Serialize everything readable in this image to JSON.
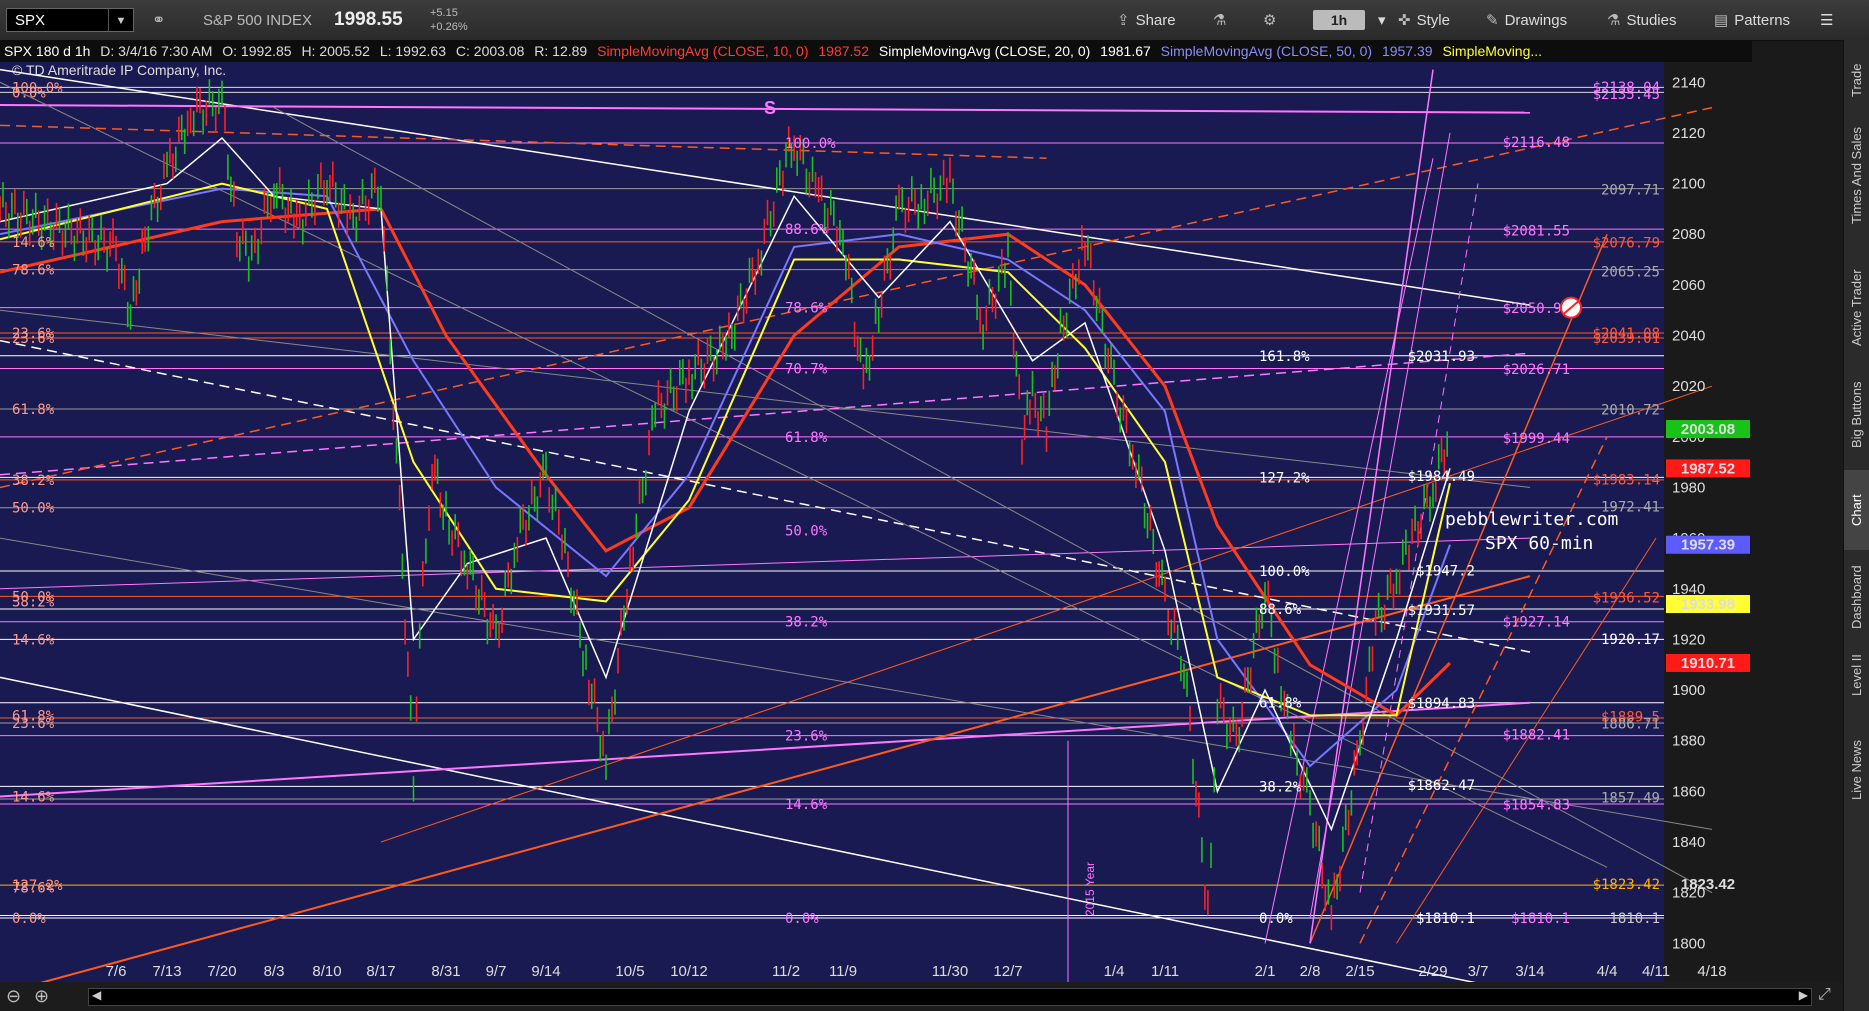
{
  "toolbar": {
    "symbol": "SPX",
    "index_name": "S&P 500 INDEX",
    "last_price": "1998.55",
    "change": "+5.15",
    "change_pct": "+0.26%",
    "share": "Share",
    "timeframe": "1h",
    "style": "Style",
    "drawings": "Drawings",
    "studies": "Studies",
    "patterns": "Patterns"
  },
  "infobar": {
    "title": "SPX 180 d 1h",
    "date": "D: 3/4/16 7:30 AM",
    "open": "O: 1992.85",
    "high": "H: 2005.52",
    "low": "L: 1992.63",
    "close": "C: 2003.08",
    "range": "R: 12.89",
    "sma10": "SimpleMovingAvg (CLOSE, 10, 0)",
    "sma10_val": "1987.52",
    "sma20": "SimpleMovingAvg (CLOSE, 20, 0)",
    "sma20_val": "1981.67",
    "sma50": "SimpleMovingAvg (CLOSE, 50, 0)",
    "sma50_val": "1957.39",
    "sma_more": "SimpleMoving..."
  },
  "sidebar": [
    "Trade",
    "Times And Sales",
    "Active Trader",
    "Big Buttons",
    "Chart",
    "Dashboard",
    "Level II",
    "Live News"
  ],
  "colors": {
    "background": "#1a1a52",
    "sma10": "#ffffff",
    "sma20": "#ffff33",
    "sma50": "#7777ff",
    "sma100": "#ff3b1e",
    "fib_pink": "#ff77ff",
    "orange": "#ff5a1e",
    "gray": "#999999"
  },
  "annotations": {
    "copyright": "© TD Ameritrade IP Company, Inc.",
    "watermark_site": "pebblewriter.com",
    "watermark_tf": "SPX 60-min",
    "s_marker": "S",
    "year_marker": "2015 Year"
  },
  "chart_data": {
    "type": "line",
    "title": "SPX 180 d 1h",
    "ylim": [
      1795,
      2148
    ],
    "yticks": [
      1800,
      1820,
      1840,
      1860,
      1880,
      1900,
      1920,
      1940,
      1960,
      1980,
      2000,
      2020,
      2040,
      2060,
      2080,
      2100,
      2120,
      2140
    ],
    "xticks": [
      "7/6",
      "7/13",
      "7/20",
      "8/3",
      "8/10",
      "8/17",
      "8/31",
      "9/7",
      "9/14",
      "10/5",
      "10/12",
      "11/2",
      "11/9",
      "11/30",
      "12/7",
      "1/4",
      "1/11",
      "2/1",
      "2/8",
      "2/15",
      "2/29",
      "3/7",
      "3/14",
      "4/4",
      "4/11",
      "4/18"
    ],
    "price_series": {
      "name": "SPX",
      "points": [
        [
          "7/1",
          2090
        ],
        [
          "7/6",
          2075
        ],
        [
          "7/8",
          2046
        ],
        [
          "7/10",
          2080
        ],
        [
          "7/13",
          2105
        ],
        [
          "7/16",
          2128
        ],
        [
          "7/20",
          2132
        ],
        [
          "7/24",
          2080
        ],
        [
          "7/28",
          2070
        ],
        [
          "8/3",
          2100
        ],
        [
          "8/6",
          2083
        ],
        [
          "8/10",
          2102
        ],
        [
          "8/13",
          2085
        ],
        [
          "8/17",
          2100
        ],
        [
          "8/21",
          1970
        ],
        [
          "8/24",
          1867
        ],
        [
          "8/26",
          1940
        ],
        [
          "8/28",
          1990
        ],
        [
          "8/31",
          1968
        ],
        [
          "9/3",
          1950
        ],
        [
          "9/7",
          1920
        ],
        [
          "9/10",
          1960
        ],
        [
          "9/14",
          1985
        ],
        [
          "9/18",
          1960
        ],
        [
          "9/24",
          1910
        ],
        [
          "9/29",
          1872
        ],
        [
          "10/5",
          1950
        ],
        [
          "10/8",
          2010
        ],
        [
          "10/12",
          2025
        ],
        [
          "10/20",
          2035
        ],
        [
          "10/27",
          2070
        ],
        [
          "11/2",
          2110
        ],
        [
          "11/3",
          2116
        ],
        [
          "11/6",
          2095
        ],
        [
          "11/9",
          2080
        ],
        [
          "11/13",
          2020
        ],
        [
          "11/16",
          2050
        ],
        [
          "11/20",
          2090
        ],
        [
          "11/25",
          2094
        ],
        [
          "11/30",
          2100
        ],
        [
          "12/4",
          2045
        ],
        [
          "12/7",
          2070
        ],
        [
          "12/11",
          2000
        ],
        [
          "12/14",
          2015
        ],
        [
          "12/18",
          2005
        ],
        [
          "12/22",
          2040
        ],
        [
          "12/29",
          2078
        ],
        [
          "1/4",
          2020
        ],
        [
          "1/7",
          1990
        ],
        [
          "1/11",
          1935
        ],
        [
          "1/15",
          1910
        ],
        [
          "1/20",
          1812
        ],
        [
          "1/22",
          1895
        ],
        [
          "1/26",
          1880
        ],
        [
          "2/1",
          1940
        ],
        [
          "2/3",
          1910
        ],
        [
          "2/5",
          1880
        ],
        [
          "2/8",
          1855
        ],
        [
          "2/11",
          1810
        ],
        [
          "2/15",
          1880
        ],
        [
          "2/18",
          1925
        ],
        [
          "2/22",
          1945
        ],
        [
          "2/25",
          1960
        ],
        [
          "2/29",
          1980
        ],
        [
          "3/4",
          2003
        ]
      ]
    },
    "sma10": [
      [
        "7/1",
        2085
      ],
      [
        "7/13",
        2100
      ],
      [
        "7/20",
        2118
      ],
      [
        "8/3",
        2095
      ],
      [
        "8/17",
        2090
      ],
      [
        "8/24",
        1920
      ],
      [
        "9/3",
        1950
      ],
      [
        "9/14",
        1960
      ],
      [
        "9/29",
        1905
      ],
      [
        "10/12",
        2010
      ],
      [
        "11/3",
        2095
      ],
      [
        "11/16",
        2055
      ],
      [
        "11/30",
        2085
      ],
      [
        "12/14",
        2030
      ],
      [
        "12/29",
        2045
      ],
      [
        "1/11",
        1955
      ],
      [
        "1/22",
        1860
      ],
      [
        "2/1",
        1900
      ],
      [
        "2/11",
        1845
      ],
      [
        "2/22",
        1920
      ],
      [
        "3/4",
        1987.52
      ]
    ],
    "sma20": [
      [
        "7/1",
        2078
      ],
      [
        "7/20",
        2100
      ],
      [
        "8/10",
        2090
      ],
      [
        "8/24",
        1990
      ],
      [
        "9/7",
        1940
      ],
      [
        "9/29",
        1935
      ],
      [
        "10/12",
        1975
      ],
      [
        "11/3",
        2070
      ],
      [
        "11/20",
        2070
      ],
      [
        "12/7",
        2065
      ],
      [
        "12/29",
        2035
      ],
      [
        "1/11",
        1990
      ],
      [
        "1/22",
        1905
      ],
      [
        "2/8",
        1890
      ],
      [
        "2/22",
        1890
      ],
      [
        "3/4",
        1981.67
      ]
    ],
    "sma50": [
      [
        "7/1",
        2080
      ],
      [
        "7/20",
        2098
      ],
      [
        "8/10",
        2095
      ],
      [
        "8/24",
        2030
      ],
      [
        "9/7",
        1980
      ],
      [
        "9/29",
        1945
      ],
      [
        "10/12",
        1985
      ],
      [
        "11/3",
        2075
      ],
      [
        "11/20",
        2080
      ],
      [
        "12/7",
        2070
      ],
      [
        "12/29",
        2050
      ],
      [
        "1/11",
        2010
      ],
      [
        "1/22",
        1920
      ],
      [
        "2/8",
        1870
      ],
      [
        "2/22",
        1900
      ],
      [
        "3/4",
        1957.39
      ]
    ],
    "sma100": [
      [
        "7/1",
        2065
      ],
      [
        "7/20",
        2085
      ],
      [
        "8/17",
        2090
      ],
      [
        "8/31",
        2040
      ],
      [
        "9/14",
        1985
      ],
      [
        "9/29",
        1955
      ],
      [
        "10/12",
        1972
      ],
      [
        "11/3",
        2040
      ],
      [
        "11/20",
        2075
      ],
      [
        "12/7",
        2080
      ],
      [
        "12/29",
        2060
      ],
      [
        "1/11",
        2020
      ],
      [
        "1/22",
        1965
      ],
      [
        "2/8",
        1910
      ],
      [
        "2/22",
        1890
      ],
      [
        "3/4",
        1910.71
      ]
    ],
    "price_labels": [
      {
        "text": "$2138.04",
        "y": 2138.04
      },
      {
        "text": "$2135.45",
        "y": 2135.45
      },
      {
        "text": "$2116.48",
        "y": 2116.48
      },
      {
        "text": "2097.71",
        "y": 2097.71
      },
      {
        "text": "$2081.55",
        "y": 2081.55
      },
      {
        "text": "$2076.79",
        "y": 2076.79
      },
      {
        "text": "2065.25",
        "y": 2065.25
      },
      {
        "text": "$2050.91",
        "y": 2050.91
      },
      {
        "text": "$2041.08",
        "y": 2041.08
      },
      {
        "text": "$2039.01",
        "y": 2039.01
      },
      {
        "text": "$2031.93",
        "y": 2031.93
      },
      {
        "text": "$2026.71",
        "y": 2026.71
      },
      {
        "text": "2010.72",
        "y": 2010.72
      },
      {
        "text": "$1999.44",
        "y": 1999.44
      },
      {
        "text": "$1984.49",
        "y": 1984.49
      },
      {
        "text": "$1983.14",
        "y": 1983.14
      },
      {
        "text": "1972.41",
        "y": 1972.41
      },
      {
        "text": "$1947.2",
        "y": 1947.2
      },
      {
        "text": "$1936.52",
        "y": 1936.52
      },
      {
        "text": "$1931.57",
        "y": 1931.57
      },
      {
        "text": "$1927.14",
        "y": 1927.14
      },
      {
        "text": "1920.17",
        "y": 1920.17
      },
      {
        "text": "$1894.83",
        "y": 1894.83
      },
      {
        "text": "$1889.5",
        "y": 1889.5
      },
      {
        "text": "1886.71",
        "y": 1886.71
      },
      {
        "text": "$1882.41",
        "y": 1882.41
      },
      {
        "text": "$1862.47",
        "y": 1862.47
      },
      {
        "text": "$1854.83",
        "y": 1854.83
      },
      {
        "text": "1857.49",
        "y": 1857.49
      },
      {
        "text": "$1823.42",
        "y": 1823.42
      },
      {
        "text": "$1810.1",
        "y": 1810.1
      },
      {
        "text": "$1810.1",
        "y": 1810.1
      },
      {
        "text": "1810.1",
        "y": 1810.1
      }
    ],
    "fib_levels_left": [
      {
        "text": "100.0%",
        "y": 2138
      },
      {
        "text": "0.0%",
        "y": 2136
      },
      {
        "text": "14.6%",
        "y": 2077
      },
      {
        "text": "78.6%",
        "y": 2066
      },
      {
        "text": "23.6%",
        "y": 2041
      },
      {
        "text": "23.6%",
        "y": 2039
      },
      {
        "text": "61.8%",
        "y": 2011
      },
      {
        "text": "38.2%",
        "y": 1983
      },
      {
        "text": "50.0%",
        "y": 1972
      },
      {
        "text": "50.0%",
        "y": 1937
      },
      {
        "text": "38.2%",
        "y": 1935
      },
      {
        "text": "14.6%",
        "y": 1920
      },
      {
        "text": "61.8%",
        "y": 1890
      },
      {
        "text": "23.6%",
        "y": 1887
      },
      {
        "text": "14.6%",
        "y": 1858
      },
      {
        "text": "127.2%",
        "y": 1823
      },
      {
        "text": "78.6%",
        "y": 1822
      },
      {
        "text": "0.0%",
        "y": 1810
      }
    ],
    "fib_levels_mid": [
      {
        "text": "100.0%",
        "y": 2116
      },
      {
        "text": "88.6%",
        "y": 2082
      },
      {
        "text": "78.6%",
        "y": 2051
      },
      {
        "text": "70.7%",
        "y": 2027
      },
      {
        "text": "61.8%",
        "y": 2000
      },
      {
        "text": "50.0%",
        "y": 1963
      },
      {
        "text": "38.2%",
        "y": 1927
      },
      {
        "text": "23.6%",
        "y": 1882
      },
      {
        "text": "14.6%",
        "y": 1855
      },
      {
        "text": "0.0%",
        "y": 1810
      }
    ],
    "fib_levels_right": [
      {
        "text": "161.8%",
        "y": 2032
      },
      {
        "text": "127.2%",
        "y": 1984
      },
      {
        "text": "100.0%",
        "y": 1947
      },
      {
        "text": "88.6%",
        "y": 1932
      },
      {
        "text": "61.8%",
        "y": 1895
      },
      {
        "text": "38.2%",
        "y": 1862
      },
      {
        "text": "0.0%",
        "y": 1810
      }
    ],
    "axis_badges": [
      {
        "text": "2003.08",
        "y": 2003.08,
        "bg": "#19c219",
        "fg": "#000"
      },
      {
        "text": "1987.52",
        "y": 1987.52,
        "bg": "#ff1a1a",
        "fg": "#fff"
      },
      {
        "text": "1957.39",
        "y": 1957.39,
        "bg": "#5b5bff",
        "fg": "#fff"
      },
      {
        "text": "1933.98",
        "y": 1933.98,
        "bg": "#ffff33",
        "fg": "#000"
      },
      {
        "text": "1910.71",
        "y": 1910.71,
        "bg": "#ff1a1a",
        "fg": "#fff"
      },
      {
        "text": "1823.42",
        "y": 1823.42,
        "bg": "none",
        "fg": "#ffb300"
      }
    ]
  }
}
